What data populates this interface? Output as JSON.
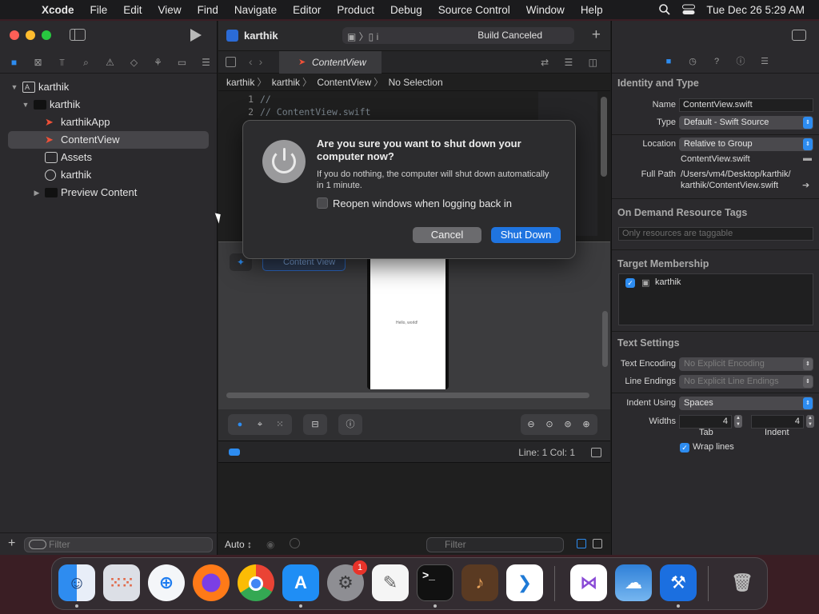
{
  "menubar": {
    "app": "Xcode",
    "items": [
      "File",
      "Edit",
      "View",
      "Find",
      "Navigate",
      "Editor",
      "Product",
      "Debug",
      "Source Control",
      "Window",
      "Help"
    ],
    "clock": "Tue Dec 26  5:29 AM"
  },
  "toolbar": {
    "project_name": "karthik",
    "scheme_target": "i",
    "status": "Build Canceled"
  },
  "navigator": {
    "tree": [
      {
        "label": "karthik",
        "icon": "project-icon"
      },
      {
        "label": "karthik",
        "icon": "folder-icon"
      },
      {
        "label": "karthikApp",
        "icon": "swift-file-icon"
      },
      {
        "label": "ContentView",
        "icon": "swift-file-icon",
        "selected": true
      },
      {
        "label": "Assets",
        "icon": "assets-icon"
      },
      {
        "label": "karthik",
        "icon": "entitlements-icon"
      },
      {
        "label": "Preview Content",
        "icon": "folder-icon"
      }
    ],
    "filter_placeholder": "Filter"
  },
  "editor": {
    "tab_label": "ContentView",
    "jump": [
      "karthik",
      "karthik",
      "ContentView",
      "No Selection"
    ],
    "code_lines": [
      {
        "n": "1",
        "t": "//"
      },
      {
        "n": "2",
        "t": "//  ContentView.swift"
      }
    ],
    "variant_label": "Content View",
    "preview_text": "Hello, world!",
    "cursor_pos": "Line: 1  Col: 1",
    "console_mode": "Auto ↕",
    "console_filter": "Filter"
  },
  "inspector": {
    "identity_title": "Identity and Type",
    "name_label": "Name",
    "name_value": "ContentView.swift",
    "type_label": "Type",
    "type_value": "Default - Swift Source",
    "location_label": "Location",
    "location_value": "Relative to Group",
    "location_file": "ContentView.swift",
    "fullpath_label": "Full Path",
    "fullpath_line1": "/Users/vm4/Desktop/karthik/",
    "fullpath_line2": "karthik/ContentView.swift",
    "tags_title": "On Demand Resource Tags",
    "tags_placeholder": "Only resources are taggable",
    "membership_title": "Target Membership",
    "membership_target": "karthik",
    "text_title": "Text Settings",
    "encoding_label": "Text Encoding",
    "encoding_value": "No Explicit Encoding",
    "endings_label": "Line Endings",
    "endings_value": "No Explicit Line Endings",
    "indent_label": "Indent Using",
    "indent_value": "Spaces",
    "widths_label": "Widths",
    "tab_width": "4",
    "indent_width": "4",
    "tab_caption": "Tab",
    "indent_caption": "Indent",
    "wrap_label": "Wrap lines"
  },
  "dialog": {
    "title": "Are you sure you want to shut down your computer now?",
    "message": "If you do nothing, the computer will shut down automatically in 1 minute.",
    "checkbox_label": "Reopen windows when logging back in",
    "cancel": "Cancel",
    "confirm": "Shut Down"
  },
  "dock": {
    "apps": [
      "finder-icon",
      "launchpad-icon",
      "safari-icon",
      "firefox-icon",
      "chrome-icon",
      "app-store-icon",
      "system-settings-icon",
      "textedit-icon",
      "terminal-icon",
      "garageband-icon",
      "vscode-icon",
      "visual-studio-icon",
      "weather-icon",
      "xcode-icon",
      "trash-icon"
    ],
    "settings_badge": "1"
  }
}
